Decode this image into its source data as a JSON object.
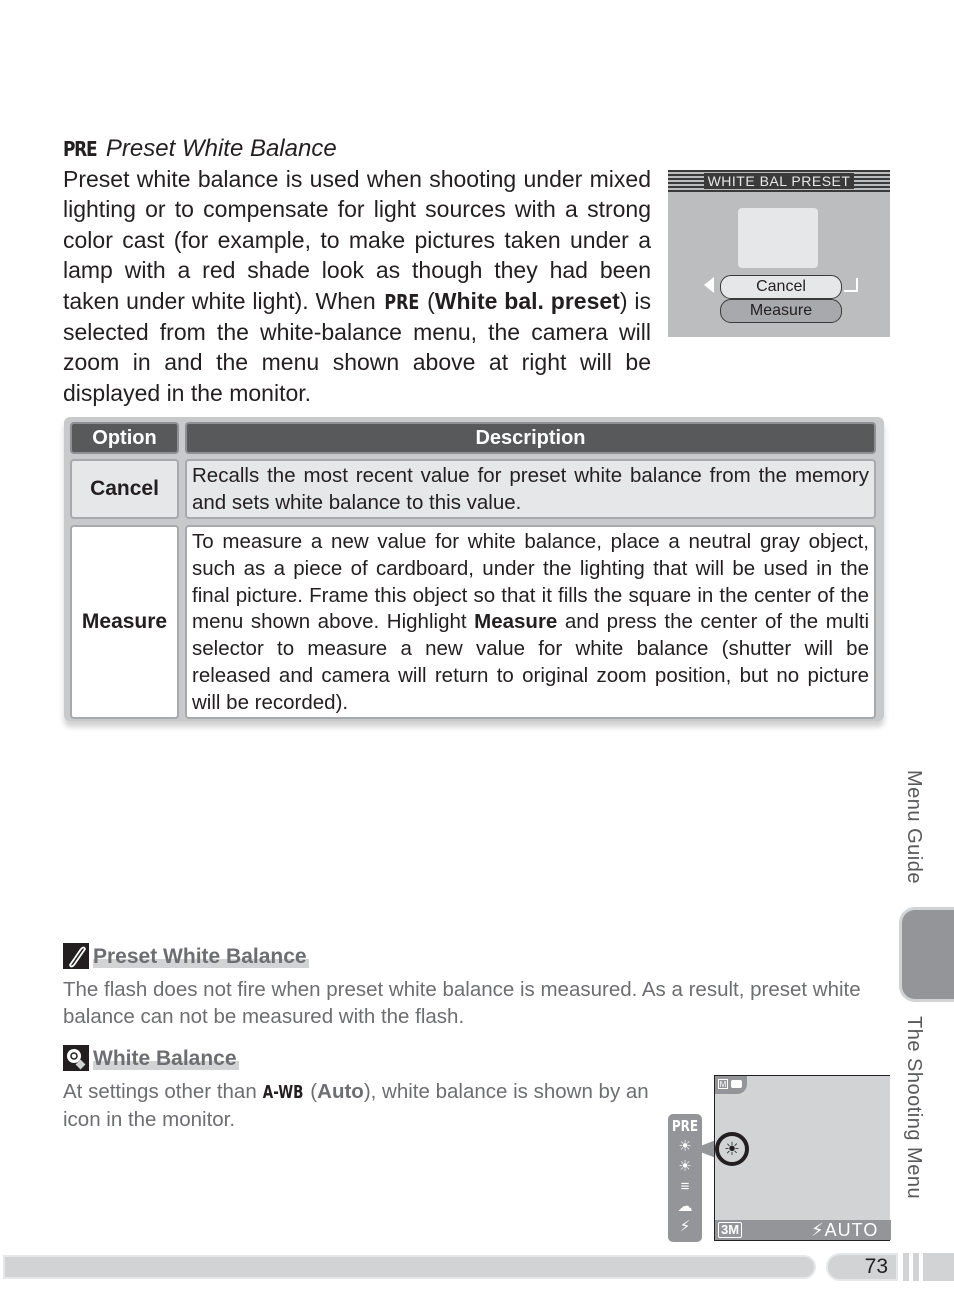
{
  "section": {
    "icon_label": "PRE",
    "title": "Preset White Balance",
    "intro_part1": "Preset white balance is used when shooting under mixed lighting or to compensate for light sources with a strong color cast (for example, to make pictures taken under a lamp with a red shade look as though they had been taken under white light).  When ",
    "intro_icon": "PRE",
    "intro_paren_open": " (",
    "intro_bold": "White bal. preset",
    "intro_part2": ") is selected from the white-balance menu, the camera will zoom in and the menu shown above at right will be displayed in the monitor."
  },
  "camera_menu": {
    "header": "WHITE BAL PRESET",
    "options": [
      "Cancel",
      "Measure"
    ],
    "selected": "Cancel",
    "icons": [
      "left-arrow-icon",
      "enter-icon"
    ]
  },
  "table": {
    "headers": [
      "Option",
      "Description"
    ],
    "rows": [
      {
        "option": "Cancel",
        "description": "Recalls the most recent value for preset white balance from the memory and sets white balance to this value."
      },
      {
        "option": "Measure",
        "description_part1": "To measure a new value for white balance, place a neutral gray object, such as a piece of cardboard, under the lighting that will be used in the final picture.  Frame this object so that it fills the square in the center of the menu shown above.  Highlight ",
        "description_bold": "Measure",
        "description_part2": " and press the center of the multi selector to measure a new value for white balance (shutter will be released and camera will return to original zoom position, but no picture will be recorded)."
      }
    ]
  },
  "notes": [
    {
      "icon": "pencil-note-icon",
      "title": "Preset White Balance",
      "body": "The flash does not fire when preset white balance is measured.  As a result, preset white balance can not be measured with the flash."
    },
    {
      "icon": "tip-bulb-icon",
      "title": "White Balance",
      "body_part1": "At settings other than ",
      "body_icon": "A-WB",
      "body_paren_open": " (",
      "body_bold": "Auto",
      "body_part2": "), white balance is shown by an icon in the monitor."
    }
  ],
  "monitor": {
    "mode_icon": "M",
    "image_size": "3M",
    "flash": "⚡AUTO",
    "wb_current": "☀",
    "wb_list": [
      "PRE",
      "☀",
      "☀",
      "≡",
      "☁",
      "⚡"
    ]
  },
  "side_tabs": {
    "upper": "Menu Guide",
    "lower": "The Shooting Menu"
  },
  "footer": {
    "page_number": "73"
  }
}
